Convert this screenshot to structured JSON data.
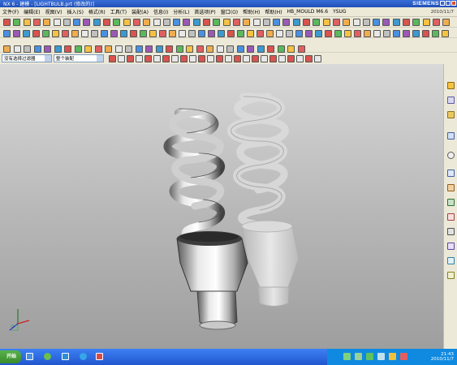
{
  "window": {
    "title": "NX 6 - 建模 - [LIGHTBULB.prt (修改的)]",
    "brand": "SIEMENS"
  },
  "menubar": {
    "items": [
      "文件(F)",
      "编辑(E)",
      "视图(V)",
      "插入(S)",
      "格式(R)",
      "工具(T)",
      "装配(A)",
      "信息(I)",
      "分析(L)",
      "首选项(P)",
      "窗口(O)",
      "帮助(H)",
      "帮助(H)",
      "HB_MOULD M6.6",
      "YSUG"
    ],
    "date": "2010/11/7"
  },
  "toolbar3": {
    "filter_select": "没有选择过滤器",
    "assembly_select": "整个装配"
  },
  "taskbar": {
    "start_label": "开始",
    "time": "21:43",
    "date": "2010/11/7"
  },
  "colors": {
    "viewport_top": "#d8d8d8",
    "viewport_bottom": "#9e9e9e",
    "taskbar": "#2156cf"
  }
}
